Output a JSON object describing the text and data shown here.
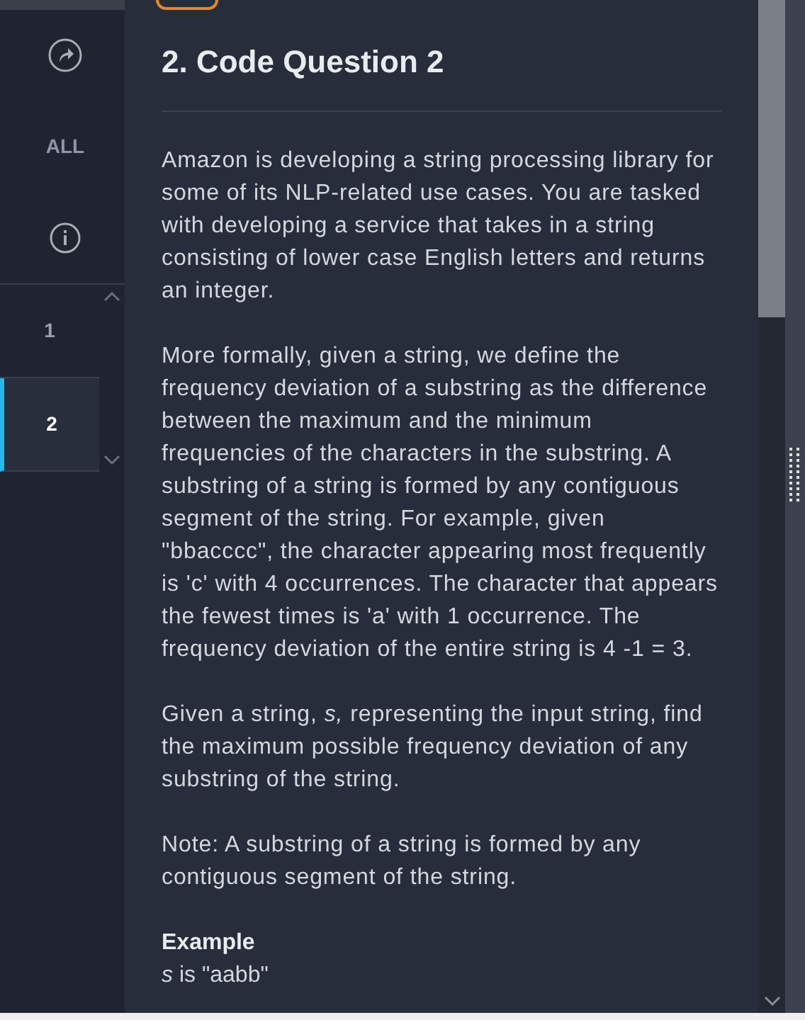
{
  "sidebar": {
    "all_label": "ALL",
    "questions": [
      {
        "label": "1",
        "selected": false
      },
      {
        "label": "2",
        "selected": true
      }
    ]
  },
  "question": {
    "title": "2. Code Question 2",
    "paragraphs": [
      "Amazon is developing a string processing library for some of its NLP-related use cases. You are tasked with developing a service that takes in a string consisting of lower case English letters and returns an integer.",
      "More formally, given a string, we define the frequency deviation of a substring as the difference between the maximum and the minimum frequencies of the characters in the substring. A substring of a string is formed by any contiguous segment of the string. For example, given \"bbacccc\", the character appearing most frequently is 'c' with 4 occurrences. The character that appears the fewest times is 'a' with 1 occurrence. The frequency deviation of the entire string is 4 -1 = 3.",
      "Given a string, *s,* representing the input string, find the maximum possible frequency deviation of any substring of the string.",
      "Note: A substring of a string is formed by any contiguous segment of the string."
    ],
    "example_heading": "Example",
    "example_line": "*s* is \"aabb\""
  }
}
